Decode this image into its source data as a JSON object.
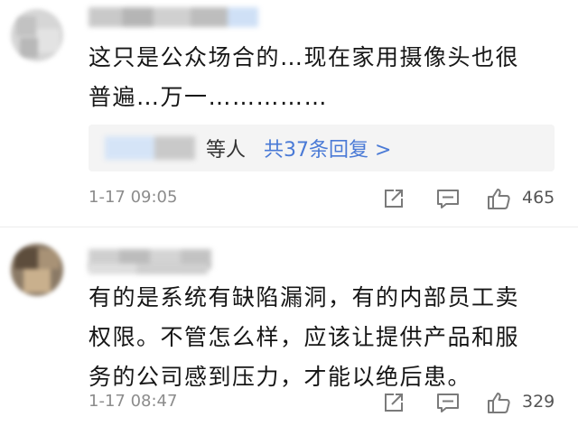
{
  "comments": [
    {
      "lines": [
        "这只是公众场合的…现在家用摄像头也很",
        "普遍…万一……………"
      ],
      "reply_suffix": "等人",
      "reply_link": "共37条回复 >",
      "time": "1-17 09:05",
      "likes": "465"
    },
    {
      "lines": [
        "有的是系统有缺陷漏洞，有的内部员工卖",
        "权限。不管怎么样，应该让提供产品和服",
        "务的公司感到压力，才能以绝后患。"
      ],
      "time": "1-17 08:47",
      "likes": "329"
    }
  ],
  "icons": {
    "share": "share-icon",
    "comment": "comment-icon",
    "like": "thumbs-up-icon"
  },
  "colors": {
    "link": "#4a7ad6",
    "meta": "#8c8c8c",
    "reply_bg": "#f4f4f4"
  }
}
